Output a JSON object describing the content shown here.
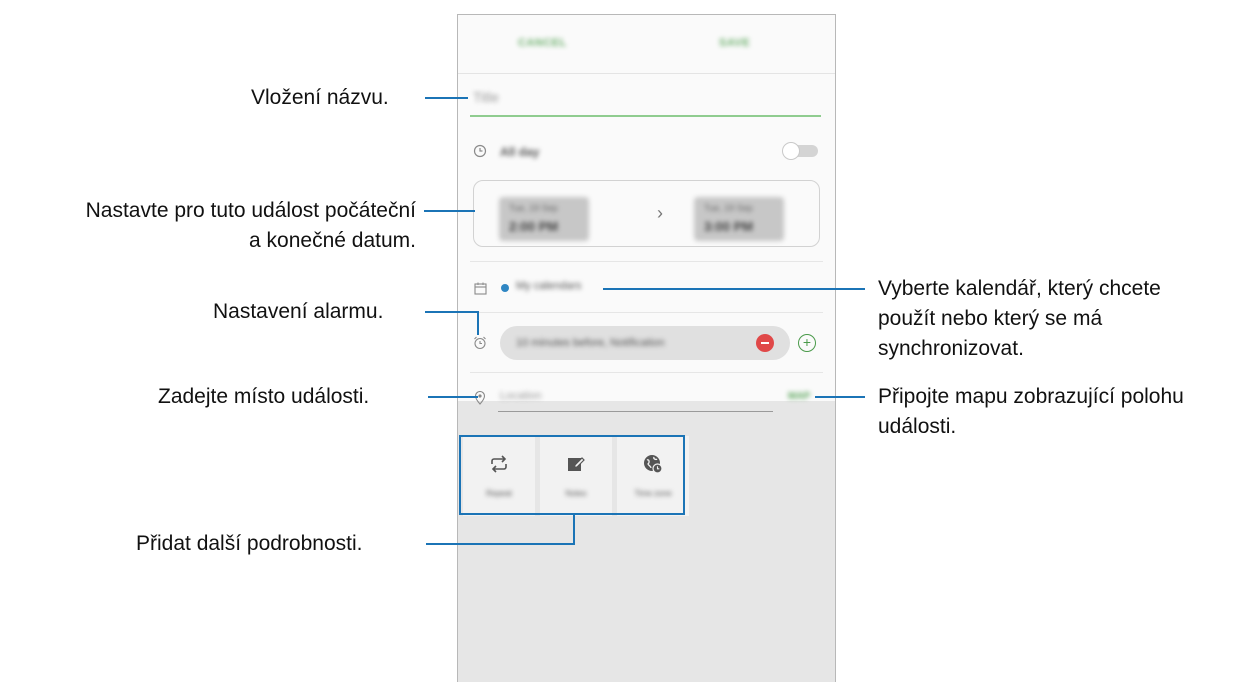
{
  "phone": {
    "action_bar": {
      "cancel_label": "CANCEL",
      "save_label": "SAVE"
    },
    "title_placeholder": "Title",
    "all_day": {
      "label": "All day",
      "icon": "clock-icon",
      "on": false
    },
    "dates": {
      "start": {
        "day": "Tue, 19 Sep",
        "time": "2:00 PM"
      },
      "end": {
        "day": "Tue, 19 Sep",
        "time": "3:00 PM"
      },
      "separator": "›"
    },
    "calendar": {
      "icon": "calendar-icon",
      "label": "My calendars",
      "color": "#2f86c3"
    },
    "alarm": {
      "icon": "alarm-clock-icon",
      "text": "10 minutes before, Notification"
    },
    "location": {
      "icon": "location-pin-icon",
      "placeholder": "Location",
      "map_label": "MAP"
    },
    "details": [
      {
        "icon": "repeat-icon",
        "label": "Repeat"
      },
      {
        "icon": "notes-icon",
        "label": "Notes"
      },
      {
        "icon": "time-zone-icon",
        "label": "Time zone"
      }
    ]
  },
  "callouts": {
    "title": "Vložení názvu.",
    "dates": [
      "Nastavte pro tuto událost počáteční",
      "a konečné datum."
    ],
    "alarm": "Nastavení alarmu.",
    "location": "Zadejte místo události.",
    "details": "Přidat další podrobnosti.",
    "calendar": [
      "Vyberte kalendář, který chcete",
      "použít nebo který se má",
      "synchronizovat."
    ],
    "map": [
      "Připojte mapu zobrazující polohu",
      "události."
    ]
  },
  "colors": {
    "leader": "#1b74b6",
    "accent_green": "#6fb16f",
    "minus_red": "#e04848"
  }
}
